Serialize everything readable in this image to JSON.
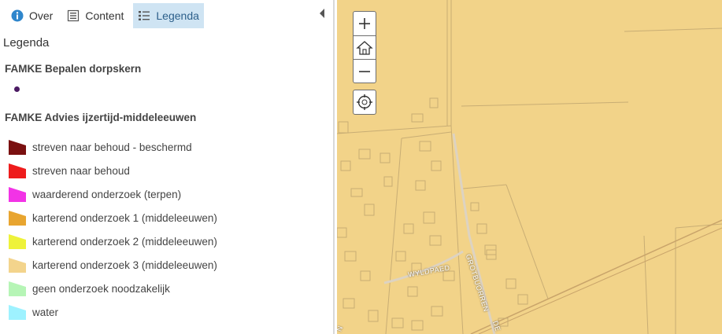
{
  "tabs": [
    {
      "label": "Over",
      "icon": "info-icon",
      "active": false
    },
    {
      "label": "Content",
      "icon": "content-list-icon",
      "active": false
    },
    {
      "label": "Legenda",
      "icon": "legend-icon",
      "active": true
    }
  ],
  "panel_title": "Legenda",
  "layers": [
    {
      "title": "FAMKE Bepalen dorpskern"
    },
    {
      "title": "FAMKE Advies ijzertijd-middeleeuwen"
    }
  ],
  "legend_items": [
    {
      "label": "streven naar behoud - beschermd",
      "color": "#7a1010"
    },
    {
      "label": "streven naar behoud",
      "color": "#ee1c1c"
    },
    {
      "label": "waarderend onderzoek (terpen)",
      "color": "#f233e6"
    },
    {
      "label": "karterend onderzoek 1 (middeleeuwen)",
      "color": "#e8a530"
    },
    {
      "label": "karterend onderzoek 2 (middeleeuwen)",
      "color": "#eef23a"
    },
    {
      "label": "karterend onderzoek 3 (middeleeuwen)",
      "color": "#f3d48c"
    },
    {
      "label": "geen onderzoek noodzakelijk",
      "color": "#b6f5b6"
    },
    {
      "label": "water",
      "color": "#9ef2ff"
    }
  ],
  "map": {
    "zoom_in": "+",
    "zoom_out": "−",
    "road_labels": [
      "WYLDPAED",
      "GROTBUORREN",
      "DE",
      "N"
    ],
    "colors": {
      "base": "#f2d389",
      "lines": "#c8ad74",
      "roads": "#c9b8a0"
    }
  }
}
